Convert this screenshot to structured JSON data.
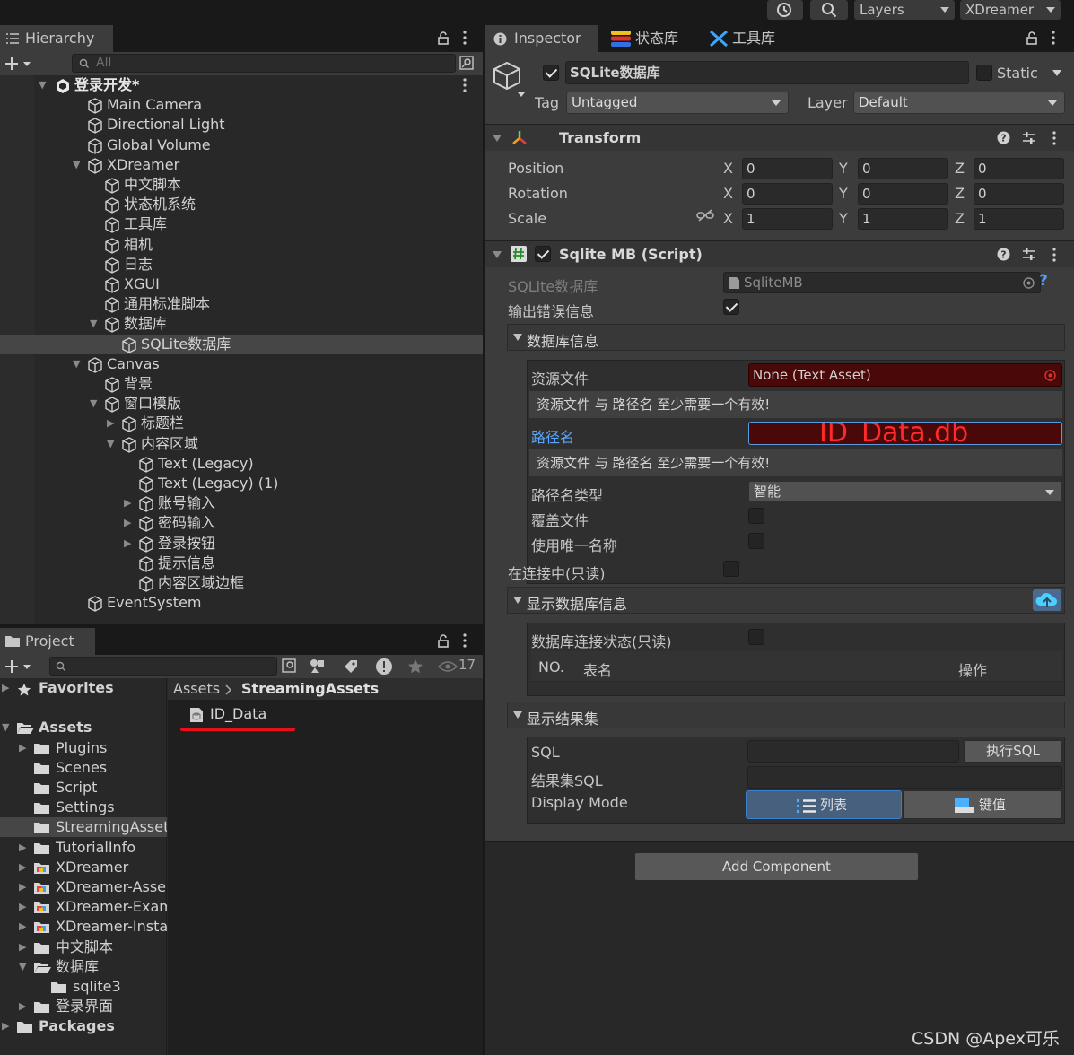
{
  "toolbar": {
    "layers_label": "Layers",
    "layout_label": "XDreamer"
  },
  "hierarchy": {
    "tab_label": "Hierarchy",
    "search_placeholder": "All",
    "rows": [
      {
        "label": "登录开发*",
        "depth": 0,
        "expanded": true,
        "scene": true
      },
      {
        "label": "Main Camera",
        "depth": 1
      },
      {
        "label": "Directional Light",
        "depth": 1
      },
      {
        "label": "Global Volume",
        "depth": 1
      },
      {
        "label": "XDreamer",
        "depth": 1,
        "expanded": true
      },
      {
        "label": "中文脚本",
        "depth": 2
      },
      {
        "label": "状态机系统",
        "depth": 2
      },
      {
        "label": "工具库",
        "depth": 2
      },
      {
        "label": "相机",
        "depth": 2
      },
      {
        "label": "日志",
        "depth": 2
      },
      {
        "label": "XGUI",
        "depth": 2
      },
      {
        "label": "通用标准脚本",
        "depth": 2
      },
      {
        "label": "数据库",
        "depth": 2,
        "expanded": true
      },
      {
        "label": "SQLite数据库",
        "depth": 3,
        "selected": true
      },
      {
        "label": "Canvas",
        "depth": 1,
        "expanded": true
      },
      {
        "label": "背景",
        "depth": 2
      },
      {
        "label": "窗口模版",
        "depth": 2,
        "expanded": true
      },
      {
        "label": "标题栏",
        "depth": 3,
        "collapsed": true
      },
      {
        "label": "内容区域",
        "depth": 3,
        "expanded": true
      },
      {
        "label": "Text (Legacy)",
        "depth": 4
      },
      {
        "label": "Text (Legacy) (1)",
        "depth": 4
      },
      {
        "label": "账号输入",
        "depth": 4,
        "collapsed": true
      },
      {
        "label": "密码输入",
        "depth": 4,
        "collapsed": true
      },
      {
        "label": "登录按钮",
        "depth": 4,
        "collapsed": true
      },
      {
        "label": "提示信息",
        "depth": 4
      },
      {
        "label": "内容区域边框",
        "depth": 4
      },
      {
        "label": "EventSystem",
        "depth": 1
      }
    ]
  },
  "project": {
    "tab_label": "Project",
    "hidden_count": "17",
    "breadcrumb": [
      "Assets",
      "StreamingAssets"
    ],
    "asset_item": "ID_Data",
    "tree": [
      {
        "label": "Favorites",
        "depth": 0,
        "collapsed": true,
        "star": true,
        "bold": true
      },
      {
        "label": "",
        "depth": 0,
        "spacer": true
      },
      {
        "label": "Assets",
        "depth": 0,
        "expanded": true,
        "bold": true,
        "open": true
      },
      {
        "label": "Plugins",
        "depth": 1,
        "collapsed": true
      },
      {
        "label": "Scenes",
        "depth": 1
      },
      {
        "label": "Script",
        "depth": 1
      },
      {
        "label": "Settings",
        "depth": 1
      },
      {
        "label": "StreamingAsset",
        "depth": 1,
        "selected": true
      },
      {
        "label": "TutorialInfo",
        "depth": 1,
        "collapsed": true
      },
      {
        "label": "XDreamer",
        "depth": 1,
        "collapsed": true,
        "pkg": true
      },
      {
        "label": "XDreamer-Asse",
        "depth": 1,
        "collapsed": true,
        "pkg": true
      },
      {
        "label": "XDreamer-Exam",
        "depth": 1,
        "collapsed": true,
        "pkg": true
      },
      {
        "label": "XDreamer-Insta",
        "depth": 1,
        "collapsed": true,
        "pkg": true
      },
      {
        "label": "中文脚本",
        "depth": 1,
        "collapsed": true
      },
      {
        "label": "数据库",
        "depth": 1,
        "expanded": true,
        "open": true
      },
      {
        "label": "sqlite3",
        "depth": 2
      },
      {
        "label": "登录界面",
        "depth": 1,
        "collapsed": true
      },
      {
        "label": "Packages",
        "depth": 0,
        "collapsed": true,
        "bold": true
      }
    ]
  },
  "inspector": {
    "tabs": [
      "Inspector",
      "状态库",
      "工具库"
    ],
    "object_name": "SQLite数据库",
    "static_label": "Static",
    "tag_label": "Tag",
    "tag_value": "Untagged",
    "layer_label": "Layer",
    "layer_value": "Default",
    "transform": {
      "title": "Transform",
      "rows": [
        {
          "label": "Position",
          "x": "0",
          "y": "0",
          "z": "0"
        },
        {
          "label": "Rotation",
          "x": "0",
          "y": "0",
          "z": "0"
        },
        {
          "label": "Scale",
          "x": "1",
          "y": "1",
          "z": "1"
        }
      ],
      "axis_x": "X",
      "axis_y": "Y",
      "axis_z": "Z"
    },
    "script": {
      "title": "Sqlite MB (Script)",
      "script_field_label": "SQLite数据库",
      "script_field_value": "SqliteMB",
      "output_error_label": "输出错误信息",
      "db_info_title": "数据库信息",
      "resource_file_label": "资源文件",
      "resource_file_value": "None (Text Asset)",
      "help_text_1": "资源文件 与 路径名 至少需要一个有效!",
      "path_label": "路径名",
      "path_value": "ID_Data.db",
      "help_text_2": "资源文件 与 路径名 至少需要一个有效!",
      "path_type_label": "路径名类型",
      "path_type_value": "智能",
      "overwrite_label": "覆盖文件",
      "unique_name_label": "使用唯一名称",
      "connecting_label": "在连接中(只读)",
      "show_db_info_title": "显示数据库信息",
      "db_conn_state_label": "数据库连接状态(只读)",
      "table_col_no": "NO.",
      "table_col_name": "表名",
      "table_col_op": "操作",
      "result_title": "显示结果集",
      "sql_label": "SQL",
      "exec_sql_label": "执行SQL",
      "result_sql_label": "结果集SQL",
      "display_mode_label": "Display Mode",
      "mode_list_label": "列表",
      "mode_kv_label": "键值"
    },
    "add_component_label": "Add Component"
  },
  "watermark": "CSDN @Apex可乐"
}
